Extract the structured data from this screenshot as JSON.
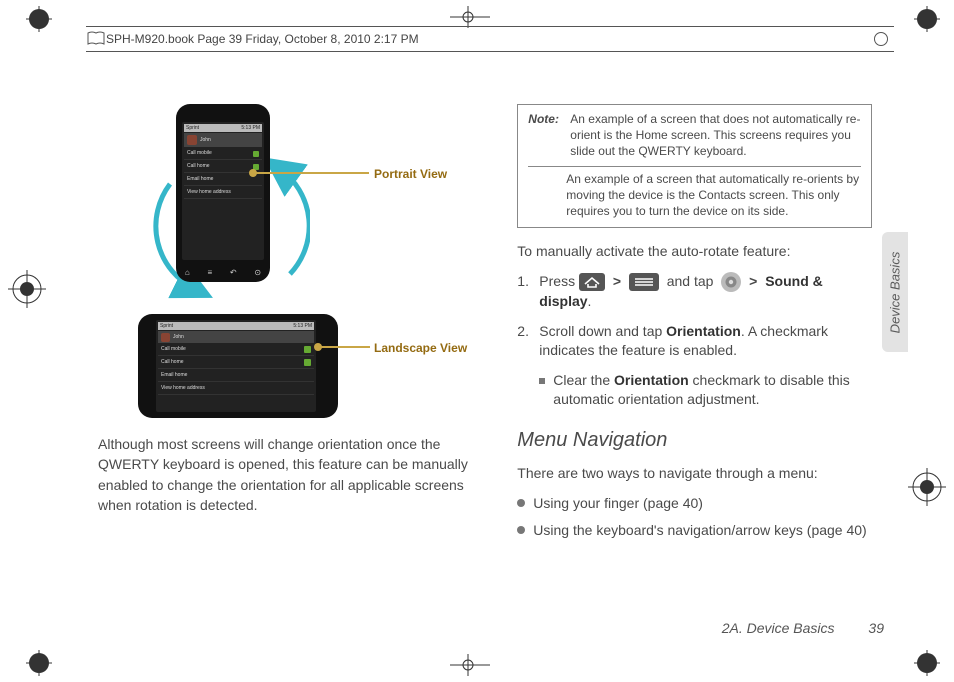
{
  "header": {
    "running_head": "SPH-M920.book  Page 39  Friday, October 8, 2010  2:17 PM"
  },
  "illustration": {
    "portrait_label": "Portrait View",
    "landscape_label": "Landscape View",
    "screen_rows": {
      "r1": "Call mobile",
      "r2": "Call home",
      "r3": "Email home",
      "r4": "View home address"
    },
    "brand": "Sprint",
    "time": "5:13 PM"
  },
  "left_para": "Although most screens will change orientation once the QWERTY keyboard is opened, this feature can be manually enabled to change the orientation for all applicable screens when rotation is detected.",
  "note": {
    "label": "Note:",
    "p1": "An example of a screen that does not automatically re-orient is the Home screen. This screens requires you slide out the QWERTY keyboard.",
    "p2": "An example of a screen that automatically re-orients by moving the device is the Contacts screen. This only requires you to turn the device on its side."
  },
  "lead_text": "To manually activate the auto-rotate feature:",
  "step1": {
    "press": "Press",
    "and_tap": "and tap",
    "sound_display": "Sound & display",
    "gt": ">"
  },
  "step2": {
    "text_a": "Scroll down and tap ",
    "bold": "Orientation",
    "text_b": ". A checkmark indicates the feature is enabled."
  },
  "sub1": {
    "a": "Clear the ",
    "bold": "Orientation",
    "b": " checkmark to disable this automatic orientation adjustment."
  },
  "section_title": "Menu Navigation",
  "nav_intro": "There are two ways to navigate through a menu:",
  "nav_items": {
    "i1": "Using your finger (page 40)",
    "i2": "Using the keyboard's navigation/arrow keys (page 40)"
  },
  "side_tab": "Device Basics",
  "footer": {
    "section": "2A. Device Basics",
    "page": "39"
  }
}
